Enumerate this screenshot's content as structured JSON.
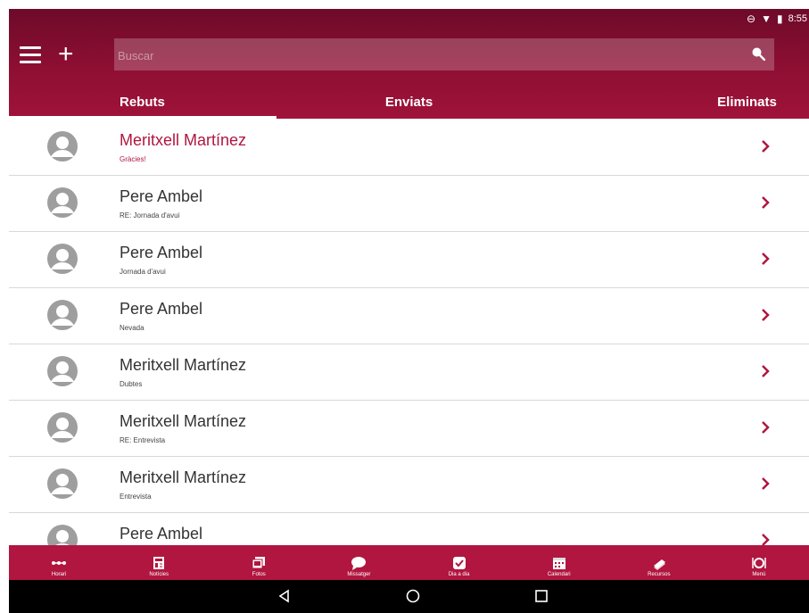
{
  "status": {
    "time": "8:55"
  },
  "header": {
    "search_placeholder": "Buscar"
  },
  "tabs": [
    {
      "label": "Rebuts",
      "active": true
    },
    {
      "label": "Enviats",
      "active": false
    },
    {
      "label": "Eliminats",
      "active": false
    }
  ],
  "messages": [
    {
      "sender": "Meritxell Martínez",
      "subject": "Gràcies!",
      "unread": true
    },
    {
      "sender": "Pere Ambel",
      "subject": "RE: Jornada d'avui",
      "unread": false
    },
    {
      "sender": "Pere Ambel",
      "subject": "Jornada d'avui",
      "unread": false
    },
    {
      "sender": "Pere Ambel",
      "subject": "Nevada",
      "unread": false
    },
    {
      "sender": "Meritxell Martínez",
      "subject": "Dubtes",
      "unread": false
    },
    {
      "sender": "Meritxell Martínez",
      "subject": "RE: Entrevista",
      "unread": false
    },
    {
      "sender": "Meritxell Martínez",
      "subject": "Entrevista",
      "unread": false
    },
    {
      "sender": "Pere Ambel",
      "subject": "",
      "unread": false
    }
  ],
  "bottom_nav": [
    {
      "label": "Horari",
      "icon": "timeline-icon"
    },
    {
      "label": "Notícies",
      "icon": "newspaper-icon"
    },
    {
      "label": "Fotos",
      "icon": "photos-icon"
    },
    {
      "label": "Missatger",
      "icon": "chat-bubble-icon"
    },
    {
      "label": "Dia a dia",
      "icon": "checkbox-icon"
    },
    {
      "label": "Calendari",
      "icon": "calendar-icon"
    },
    {
      "label": "Recursos",
      "icon": "books-icon"
    },
    {
      "label": "Menú",
      "icon": "dining-icon"
    }
  ],
  "colors": {
    "primary": "#b0163f",
    "header_dark": "#6e0a2a",
    "unread_text": "#b0163f"
  }
}
